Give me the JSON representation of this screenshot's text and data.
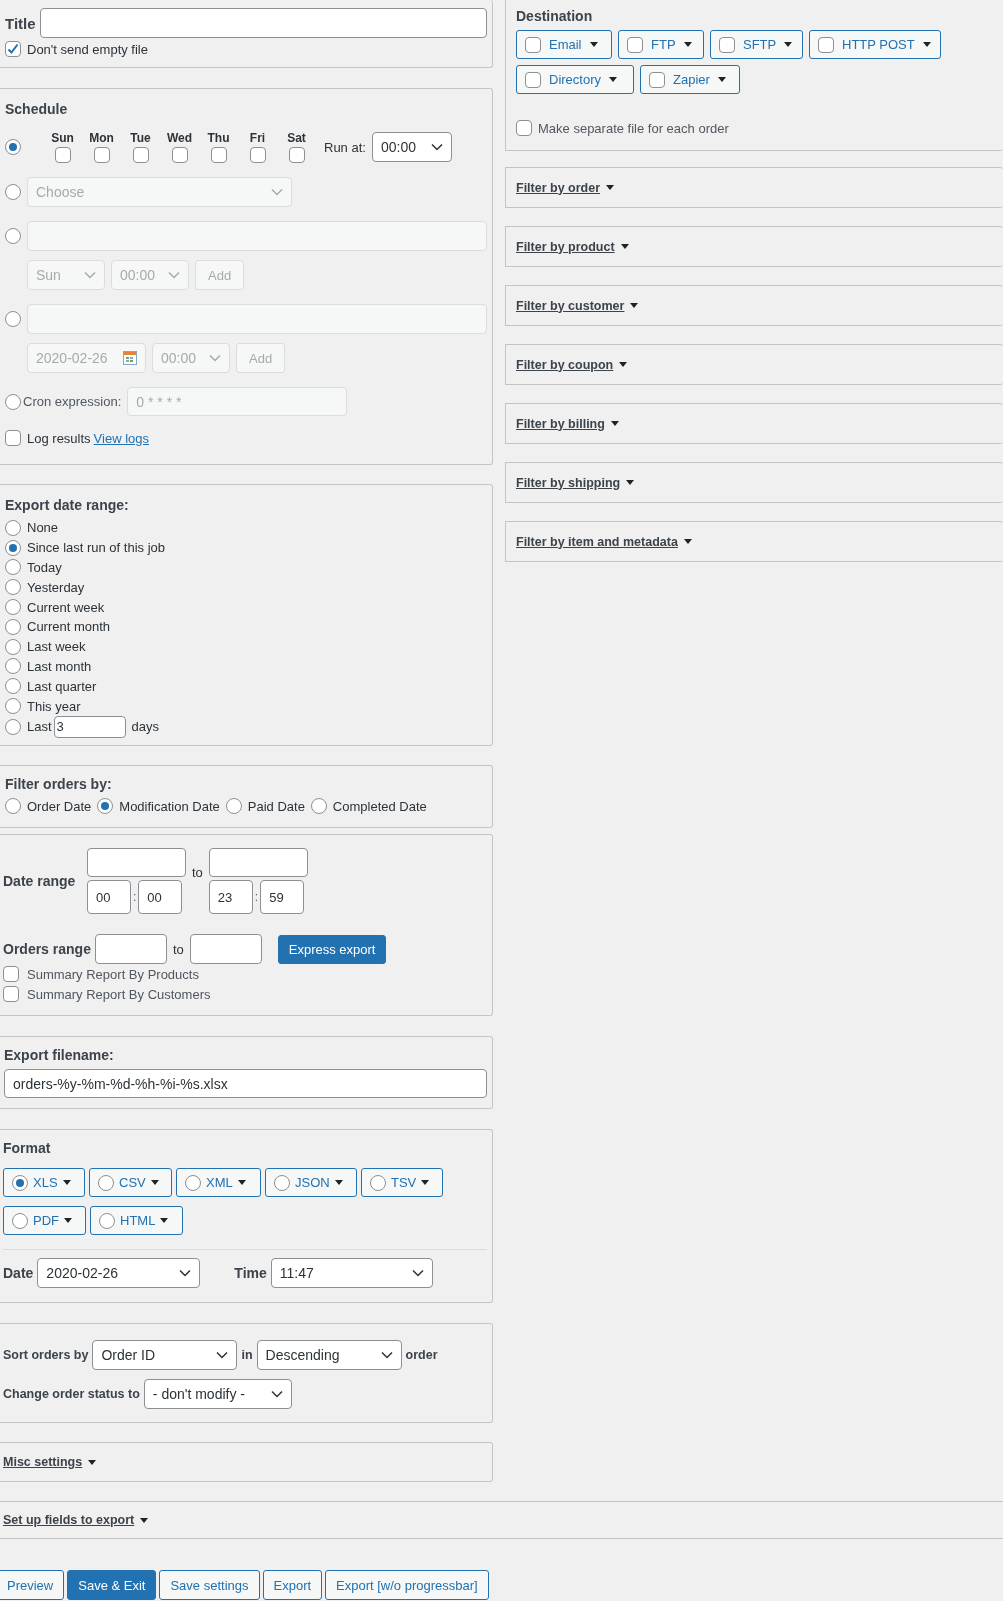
{
  "title_field": {
    "label": "Title"
  },
  "dont_send_empty": {
    "label": "Don't send empty file",
    "checked": true
  },
  "schedule": {
    "heading": "Schedule",
    "options": [
      {
        "kind": "weekdays",
        "selected": true,
        "days": [
          {
            "label": "Sun",
            "checked": false
          },
          {
            "label": "Mon",
            "checked": false
          },
          {
            "label": "Tue",
            "checked": false
          },
          {
            "label": "Wed",
            "checked": false
          },
          {
            "label": "Thu",
            "checked": false
          },
          {
            "label": "Fri",
            "checked": false
          },
          {
            "label": "Sat",
            "checked": false
          }
        ],
        "run_at_label": "Run at:",
        "run_at": "00:00"
      },
      {
        "kind": "choose",
        "selected": false,
        "placeholder": "Choose"
      },
      {
        "kind": "weekly",
        "selected": false,
        "day": "Sun",
        "time": "00:00",
        "button": "Add"
      },
      {
        "kind": "dates",
        "selected": false,
        "date": "2020-02-26",
        "time": "00:00",
        "button": "Add"
      },
      {
        "kind": "cron",
        "selected": false,
        "label": "Cron expression:",
        "placeholder": "0 * * * *"
      }
    ],
    "log": {
      "label": "Log results",
      "checked": false,
      "link": "View logs"
    }
  },
  "export_date_range": {
    "heading": "Export date range:",
    "options": [
      {
        "kind": "plain",
        "label": "None",
        "selected": false
      },
      {
        "kind": "plain",
        "label": "Since last run of this job",
        "selected": true
      },
      {
        "kind": "plain",
        "label": "Today",
        "selected": false
      },
      {
        "kind": "plain",
        "label": "Yesterday",
        "selected": false
      },
      {
        "kind": "plain",
        "label": "Current week",
        "selected": false
      },
      {
        "kind": "plain",
        "label": "Current month",
        "selected": false
      },
      {
        "kind": "plain",
        "label": "Last week",
        "selected": false
      },
      {
        "kind": "plain",
        "label": "Last month",
        "selected": false
      },
      {
        "kind": "plain",
        "label": "Last quarter",
        "selected": false
      },
      {
        "kind": "plain",
        "label": "This year",
        "selected": false
      },
      {
        "kind": "days",
        "label": "Last",
        "value": "3",
        "suffix": "days",
        "selected": false
      }
    ]
  },
  "filter_orders_by": {
    "heading": "Filter orders by:",
    "options": [
      {
        "label": "Order Date",
        "selected": false
      },
      {
        "label": "Modification Date",
        "selected": true
      },
      {
        "label": "Paid Date",
        "selected": false
      },
      {
        "label": "Completed Date",
        "selected": false
      }
    ]
  },
  "date_range": {
    "label": "Date range",
    "to": "to",
    "from_time": {
      "hour": "00",
      "sep": ":",
      "minute": "00"
    },
    "to_time": {
      "hour": "23",
      "sep": ":",
      "minute": "59"
    }
  },
  "orders_range": {
    "label": "Orders range",
    "to": "to",
    "button": "Express export"
  },
  "summary_reports": [
    {
      "label": "Summary Report By Products",
      "checked": false
    },
    {
      "label": "Summary Report By Customers",
      "checked": false
    }
  ],
  "export_filename": {
    "heading": "Export filename:",
    "value": "orders-%y-%m-%d-%h-%i-%s.xlsx"
  },
  "format": {
    "heading": "Format",
    "options": [
      {
        "label": "XLS",
        "selected": true
      },
      {
        "label": "CSV",
        "selected": false
      },
      {
        "label": "XML",
        "selected": false
      },
      {
        "label": "JSON",
        "selected": false
      },
      {
        "label": "TSV",
        "selected": false
      },
      {
        "label": "PDF",
        "selected": false
      },
      {
        "label": "HTML",
        "selected": false
      }
    ],
    "date_label": "Date",
    "date": "2020-02-26",
    "time_label": "Time",
    "time": "11:47"
  },
  "sort": {
    "label": "Sort orders by",
    "field": "Order ID",
    "in": "in",
    "direction": "Descending",
    "suffix": "order",
    "status_label": "Change order status to",
    "status": "- don't modify -"
  },
  "misc_settings": {
    "label": "Misc settings"
  },
  "setup_fields": {
    "label": "Set up fields to export"
  },
  "buttons": [
    {
      "label": "Preview",
      "kind": "secondary"
    },
    {
      "label": "Save & Exit",
      "kind": "primary"
    },
    {
      "label": "Save settings",
      "kind": "secondary"
    },
    {
      "label": "Export",
      "kind": "secondary"
    },
    {
      "label": "Export [w/o progressbar]",
      "kind": "secondary"
    }
  ],
  "destination": {
    "heading": "Destination",
    "options": [
      {
        "label": "Email",
        "checked": false
      },
      {
        "label": "FTP",
        "checked": false
      },
      {
        "label": "SFTP",
        "checked": false
      },
      {
        "label": "HTTP POST",
        "checked": false
      },
      {
        "label": "Directory",
        "checked": false
      },
      {
        "label": "Zapier",
        "checked": false
      }
    ],
    "separate": {
      "label": "Make separate file for each order",
      "checked": false
    }
  },
  "filters": [
    {
      "label": "Filter by order"
    },
    {
      "label": "Filter by product"
    },
    {
      "label": "Filter by customer"
    },
    {
      "label": "Filter by coupon"
    },
    {
      "label": "Filter by billing"
    },
    {
      "label": "Filter by shipping"
    },
    {
      "label": "Filter by item and metadata"
    }
  ]
}
